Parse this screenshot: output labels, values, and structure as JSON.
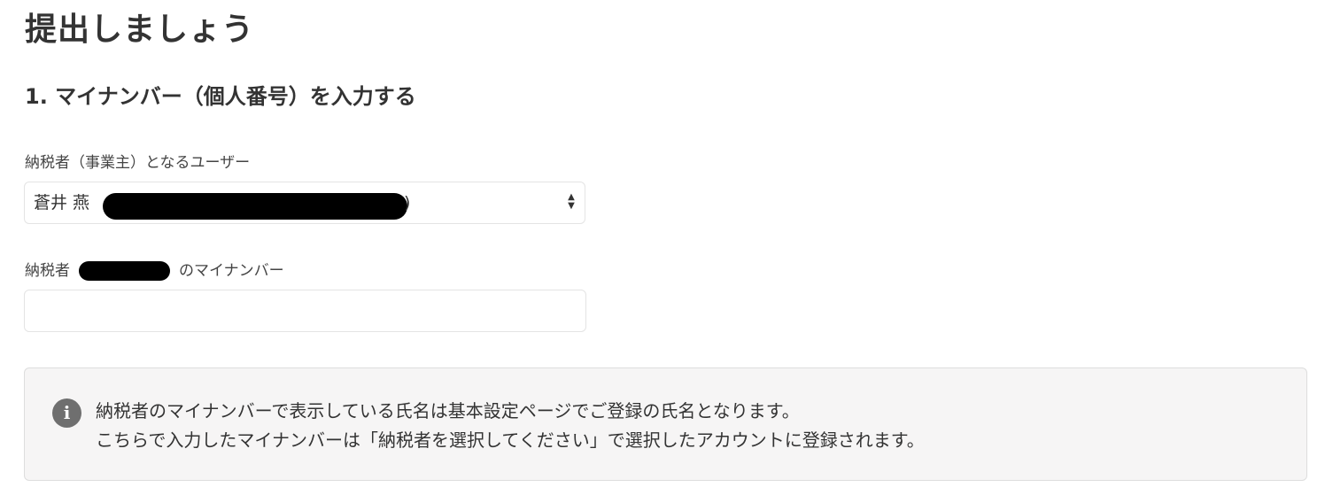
{
  "page": {
    "title": "提出しましょう"
  },
  "section": {
    "title": "1. マイナンバー（個人番号）を入力する"
  },
  "user_field": {
    "label": "納税者（事業主）となるユーザー",
    "selected_value": "蒼井 燕",
    "selected_value_suffix": ")"
  },
  "mynumber_field": {
    "label_prefix": "納税者",
    "label_suffix": "のマイナンバー",
    "value": "",
    "placeholder": ""
  },
  "info": {
    "icon": "info-icon",
    "icon_glyph": "i",
    "line1": "納税者のマイナンバーで表示している氏名は基本設定ページでご登録の氏名となります。",
    "line2": "こちらで入力したマイナンバーは「納税者を選択してください」で選択したアカウントに登録されます。"
  },
  "colors": {
    "text": "#333333",
    "border": "#e4e4e4",
    "info_background": "#f6f5f5",
    "info_icon": "#6f6f6f",
    "redaction": "#000000"
  }
}
